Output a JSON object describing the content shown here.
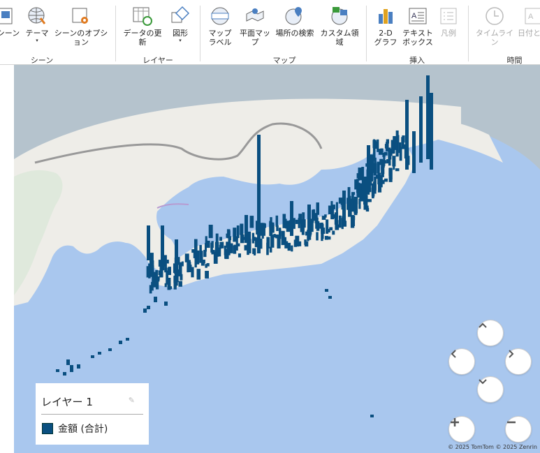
{
  "ribbon": {
    "buttons": [
      {
        "id": "scene",
        "label": "シーン",
        "icon": "scene-icon"
      },
      {
        "id": "theme",
        "label": "テーマ",
        "icon": "theme-globe-icon",
        "caret": "▾"
      },
      {
        "id": "scene_options",
        "label": "シーンのオプション",
        "icon": "scene-options-icon"
      },
      {
        "id": "refresh",
        "label": "データの更新",
        "icon": "refresh-data-icon"
      },
      {
        "id": "shape",
        "label": "図形",
        "icon": "shapes-icon",
        "caret": "▾"
      },
      {
        "id": "map_labels",
        "label": "マップ\nラベル",
        "icon": "map-labels-icon"
      },
      {
        "id": "flat_map",
        "label": "平面マップ",
        "icon": "flat-map-icon"
      },
      {
        "id": "find_location",
        "label": "場所の検索",
        "icon": "find-location-icon"
      },
      {
        "id": "custom_regions",
        "label": "カスタム領域",
        "icon": "custom-regions-icon"
      },
      {
        "id": "chart2d",
        "label": "2-D\nグラフ",
        "icon": "chart-2d-icon"
      },
      {
        "id": "textbox",
        "label": "テキスト\nボックス",
        "icon": "text-box-icon"
      },
      {
        "id": "legend",
        "label": "凡例",
        "icon": "legend-icon",
        "disabled": true
      },
      {
        "id": "timeline",
        "label": "タイムライン",
        "icon": "timeline-icon",
        "disabled": true
      },
      {
        "id": "datetime",
        "label": "日付と時",
        "icon": "date-time-icon",
        "disabled": true
      }
    ],
    "groups": {
      "scene": "シーン",
      "layer": "レイヤー",
      "map": "マップ",
      "insert": "挿入",
      "time": "時間"
    }
  },
  "legend": {
    "title": "レイヤー 1",
    "series": "金額 (合計)",
    "color": "#0a4f80"
  },
  "copyright": "© 2025 TomTom  © 2025 Zenrin",
  "colors": {
    "ocean": "#a9c7ee",
    "land": "#eeede8",
    "bars": "#0a4f80"
  }
}
